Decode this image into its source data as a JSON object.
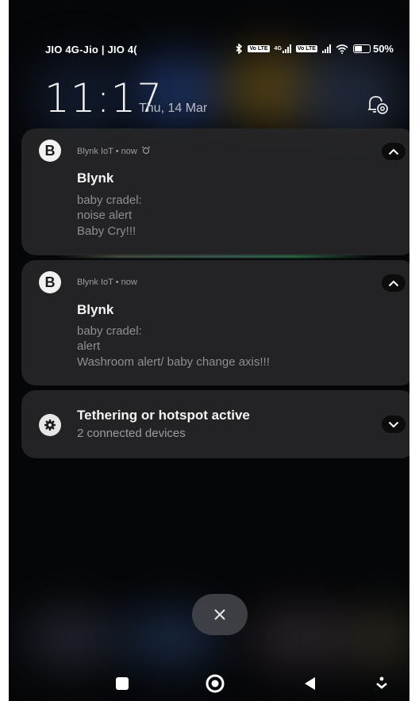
{
  "status_bar": {
    "carrier": "JIO 4G-Jio | JIO 4(",
    "network_4g": "4G",
    "volte": "Vo LTE",
    "battery": "50%",
    "battery_level": 0.5
  },
  "lockscreen": {
    "time": "11:17",
    "date": "Thu, 14 Mar"
  },
  "notifications": [
    {
      "app_icon_letter": "B",
      "app_line": "Blynk IoT • now",
      "title": "Blynk",
      "lines": [
        "baby cradel:",
        "noise alert",
        "Baby Cry!!!"
      ],
      "has_alarm_icon": true
    },
    {
      "app_icon_letter": "B",
      "app_line": "Blynk IoT • now",
      "title": "Blynk",
      "lines": [
        "baby cradel:",
        "alert",
        "Washroom alert/ baby change axis!!!"
      ],
      "has_alarm_icon": false
    },
    {
      "title": "Tethering or hotspot active",
      "subtitle": "2 connected devices",
      "icon": "gear-icon"
    }
  ],
  "dismiss_icon": "close-icon",
  "colors": {
    "card_bg": "#262628",
    "accent_text": "#f4f4f4",
    "muted_text": "#8d8f94"
  }
}
